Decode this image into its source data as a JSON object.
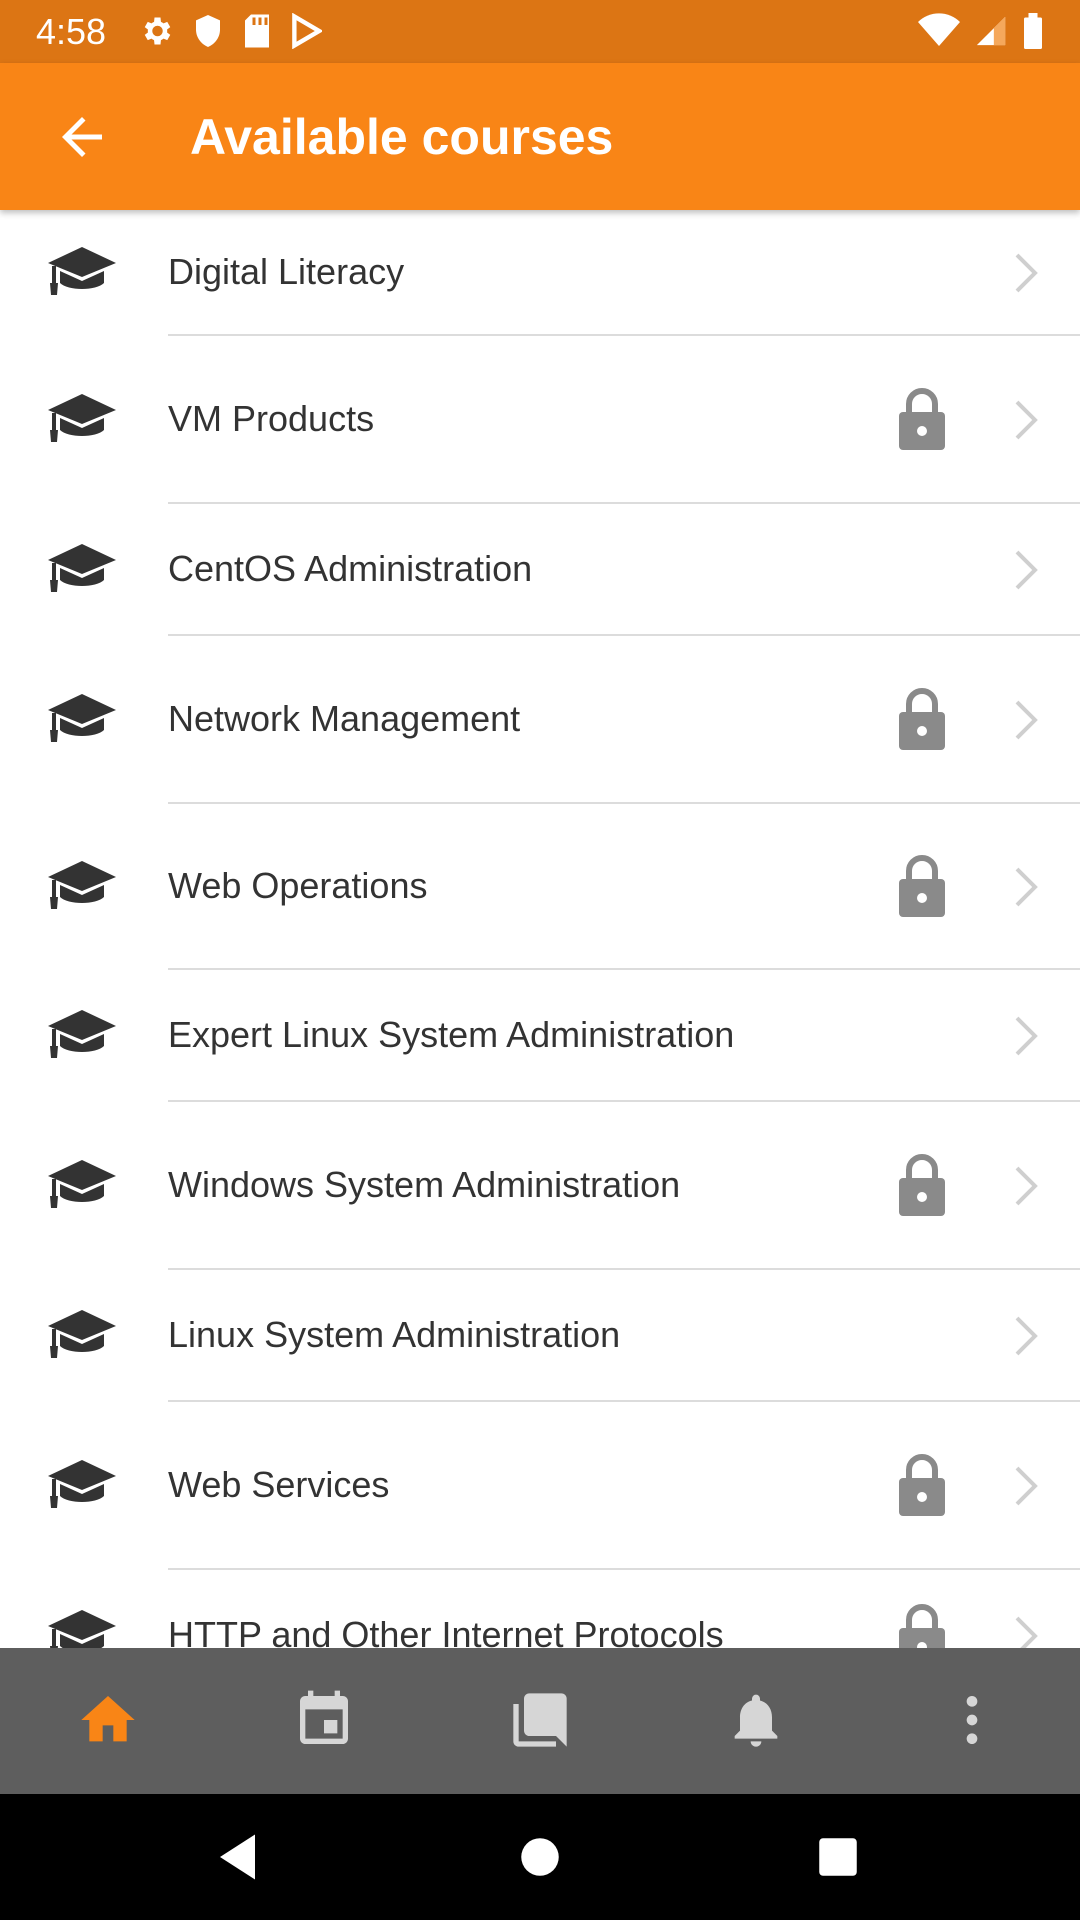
{
  "status_bar": {
    "time": "4:58",
    "left_icons": [
      "gear-icon",
      "shield-icon",
      "sd-card-icon",
      "play-store-icon"
    ],
    "right_icons": [
      "wifi-icon",
      "signal-icon",
      "battery-icon"
    ]
  },
  "app_bar": {
    "title": "Available courses",
    "back_icon": "arrow-back-icon",
    "background": "#F98516"
  },
  "courses": [
    {
      "name": "Digital Literacy",
      "locked": false
    },
    {
      "name": "VM Products",
      "locked": true
    },
    {
      "name": "CentOS Administration",
      "locked": false
    },
    {
      "name": "Network Management",
      "locked": true
    },
    {
      "name": "Web Operations",
      "locked": true
    },
    {
      "name": "Expert Linux System Administration",
      "locked": false
    },
    {
      "name": "Windows System Administration",
      "locked": true
    },
    {
      "name": "Linux System Administration",
      "locked": false
    },
    {
      "name": "Web Services",
      "locked": true
    },
    {
      "name": "HTTP and Other Internet Protocols",
      "locked": true
    }
  ],
  "bottom_nav": {
    "items": [
      {
        "icon": "home-icon",
        "active": true
      },
      {
        "icon": "calendar-icon",
        "active": false
      },
      {
        "icon": "messages-icon",
        "active": false
      },
      {
        "icon": "bell-icon",
        "active": false
      },
      {
        "icon": "more-vert-icon",
        "active": false
      }
    ],
    "active_color": "#F98516",
    "inactive_color": "#D6D6D6"
  },
  "system_nav": [
    "back-triangle-icon",
    "home-circle-icon",
    "recents-square-icon"
  ]
}
